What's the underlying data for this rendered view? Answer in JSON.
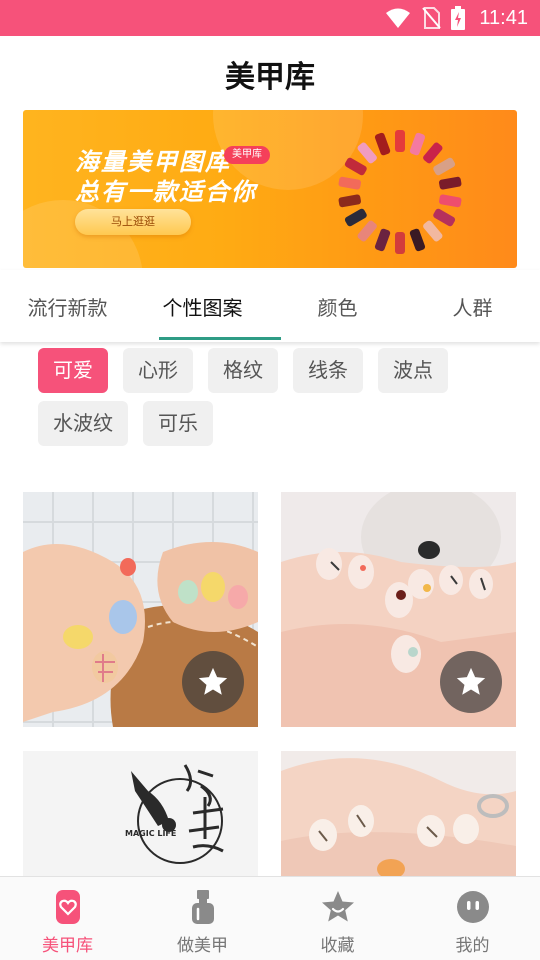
{
  "status_bar": {
    "time": "11:41"
  },
  "app_bar": {
    "title": "美甲库"
  },
  "banner": {
    "line1": "海量美甲图库",
    "line2": "总有一款适合你",
    "badge": "美甲库",
    "button_label": "马上逛逛"
  },
  "tabs": [
    {
      "label": "流行新款",
      "active": false
    },
    {
      "label": "个性图案",
      "active": true
    },
    {
      "label": "颜色",
      "active": false
    },
    {
      "label": "人群",
      "active": false
    }
  ],
  "chips": [
    {
      "label": "可爱",
      "active": true
    },
    {
      "label": "心形",
      "active": false
    },
    {
      "label": "格纹",
      "active": false
    },
    {
      "label": "线条",
      "active": false
    },
    {
      "label": "波点",
      "active": false
    },
    {
      "label": "水波纹",
      "active": false
    },
    {
      "label": "可乐",
      "active": false
    }
  ],
  "gallery": {
    "logo_text": "MAGIC LIFE"
  },
  "bottom_nav": [
    {
      "label": "美甲库",
      "icon": "heart-phone-icon",
      "active": true
    },
    {
      "label": "做美甲",
      "icon": "nail-polish-icon",
      "active": false
    },
    {
      "label": "收藏",
      "icon": "star-icon",
      "active": false
    },
    {
      "label": "我的",
      "icon": "profile-icon",
      "active": false
    }
  ],
  "colors": {
    "accent": "#f6527a",
    "tab_indicator": "#2f9c85",
    "banner": "#ffab13"
  }
}
